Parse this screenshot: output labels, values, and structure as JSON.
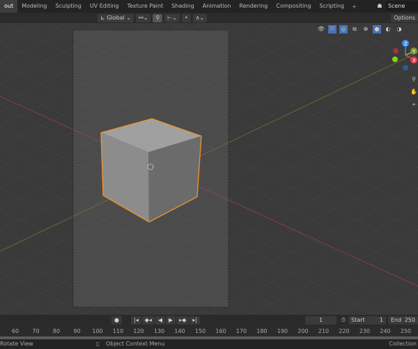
{
  "workspace_tabs": [
    "out",
    "Modeling",
    "Sculpting",
    "UV Editing",
    "Texture Paint",
    "Shading",
    "Animation",
    "Rendering",
    "Compositing",
    "Scripting"
  ],
  "active_tab": 0,
  "add_tab": "+",
  "scene": {
    "label": "Scene"
  },
  "header": {
    "orientation": "Global",
    "options": "Options"
  },
  "gizmo": {
    "z": "Z",
    "y": "Y",
    "x": "X"
  },
  "timeline": {
    "current_frame": "1",
    "start_label": "Start",
    "start": "1",
    "end_label": "End",
    "end": "250"
  },
  "ruler_ticks": [
    "60",
    "70",
    "80",
    "90",
    "100",
    "110",
    "120",
    "130",
    "140",
    "150",
    "160",
    "170",
    "180",
    "190",
    "200",
    "210",
    "220",
    "230",
    "240",
    "250"
  ],
  "status": {
    "left": "Rotate View",
    "middle": "Object Context Menu",
    "right": "Collection"
  }
}
